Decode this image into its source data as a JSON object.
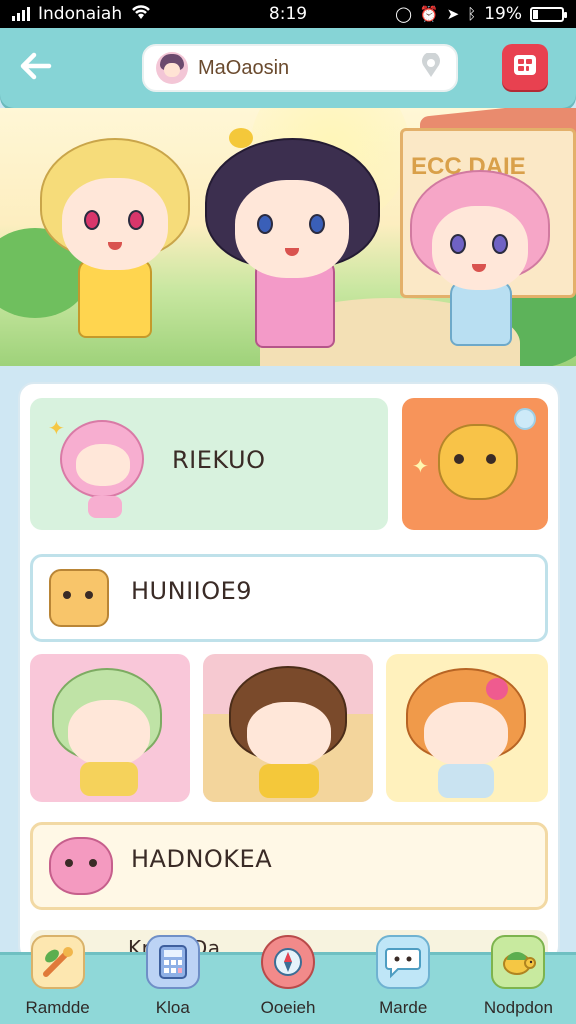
{
  "status_bar": {
    "carrier": "Indonaiah",
    "time": "8:19",
    "battery_text": "19%",
    "battery_level": 0.19
  },
  "header": {
    "search_text": "MaOaosin",
    "back_icon": "arrow-left-icon",
    "location_icon": "location-pin-icon",
    "menu_icon": "grid-menu-icon",
    "accent": "#e84150"
  },
  "hero": {
    "sign_text": "ECC DAIE"
  },
  "cards": {
    "featured_label": "RIEKUO",
    "row2_label": "HUNIIOE9",
    "row4_label": "HADNOKEA",
    "row5_label": "Kr... DDa"
  },
  "bottom_nav": {
    "items": [
      {
        "label": "Ramdde",
        "icon": "leaf-pencil-icon"
      },
      {
        "label": "Kloa",
        "icon": "calculator-icon"
      },
      {
        "label": "Ooeieh",
        "icon": "compass-icon"
      },
      {
        "label": "Marde",
        "icon": "chat-bubble-icon"
      },
      {
        "label": "Nodpdon",
        "icon": "turtle-icon"
      }
    ]
  }
}
